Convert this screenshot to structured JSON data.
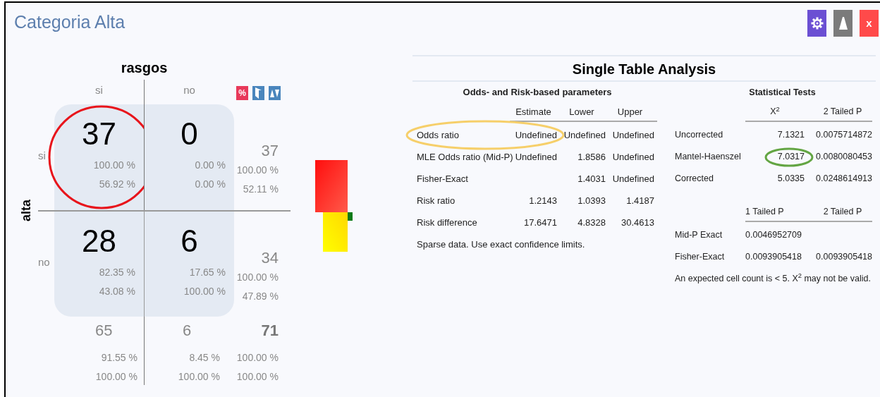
{
  "window": {
    "title": "Categoria Alta",
    "buttons": [
      {
        "kind": "settings"
      },
      {
        "kind": "collapse"
      },
      {
        "kind": "close",
        "label": "x"
      }
    ]
  },
  "crosstab": {
    "column_variable": "rasgos",
    "row_variable": "alta",
    "column_labels": [
      "si",
      "no"
    ],
    "tools": [
      {
        "kind": "percent",
        "label": "%"
      },
      {
        "kind": "swap"
      },
      {
        "kind": "sort"
      }
    ],
    "rows": [
      {
        "label": "si",
        "cells": [
          {
            "count": "37",
            "row_pct": "100.00 %",
            "col_pct": "56.92 %",
            "circled": true
          },
          {
            "count": "0",
            "row_pct": "0.00 %",
            "col_pct": "0.00 %",
            "circled": false
          }
        ],
        "total": {
          "count": "37",
          "row_pct": "100.00 %",
          "col_pct": "52.11 %"
        }
      },
      {
        "label": "no",
        "cells": [
          {
            "count": "28",
            "row_pct": "82.35 %",
            "col_pct": "43.08 %",
            "circled": false
          },
          {
            "count": "6",
            "row_pct": "17.65 %",
            "col_pct": "100.00 %",
            "circled": false
          }
        ],
        "total": {
          "count": "34",
          "row_pct": "100.00 %",
          "col_pct": "47.89 %"
        }
      }
    ],
    "totals": {
      "cells": [
        {
          "count": "65",
          "row_pct": "91.55 %",
          "col_pct": "100.00 %"
        },
        {
          "count": "6",
          "row_pct": "8.45 %",
          "col_pct": "100.00 %"
        }
      ],
      "grand": {
        "count": "71",
        "row_pct": "100.00 %",
        "col_pct": "100.00 %"
      }
    }
  },
  "analysis": {
    "title": "Single Table Analysis",
    "odds": {
      "title": "Odds- and Risk-based parameters",
      "columns": [
        "Estimate",
        "Lower",
        "Upper"
      ],
      "rows": [
        {
          "label": "Odds ratio",
          "values": {
            "estimate": "Undefined",
            "lower": "Undefined",
            "upper": "Undefined"
          },
          "circled": true
        },
        {
          "label": "MLE Odds ratio (Mid-P)",
          "values": {
            "estimate": "Undefined",
            "lower": "1.8586",
            "upper": "Undefined"
          },
          "circled": false
        },
        {
          "label": "Fisher-Exact",
          "values": {
            "lower": "1.4031",
            "upper": "Undefined"
          },
          "circled": false
        },
        {
          "label": "Risk ratio",
          "values": {
            "estimate": "1.2143",
            "lower": "1.0393",
            "upper": "1.4187"
          },
          "circled": false
        },
        {
          "label": "Risk difference",
          "values": {
            "estimate": "17.6471",
            "lower": "4.8328",
            "upper": "30.4613"
          },
          "circled": false
        }
      ],
      "note": "Sparse data. Use exact confidence limits."
    },
    "tests": {
      "title": "Statistical Tests",
      "columns": [
        "X$^{2}$",
        "2 Tailed P"
      ],
      "rows": [
        {
          "label": "Uncorrected",
          "values": {
            "chi_square": "7.1321",
            "two_tailed_p": "0.0075714872"
          },
          "circled": false
        },
        {
          "label": "Mantel-Haenszel",
          "values": {
            "chi_square": "7.0317",
            "two_tailed_p": "0.0080080453"
          },
          "circled": true
        },
        {
          "label": "Corrected",
          "values": {
            "chi_square": "5.0335",
            "two_tailed_p": "0.0248614913"
          },
          "circled": false
        }
      ],
      "exact_columns": [
        "1 Tailed P",
        "2 Tailed P"
      ],
      "exact_rows": [
        {
          "label": "Mid-P Exact",
          "values": {
            "one_tailed_p": "0.0046952709"
          }
        },
        {
          "label": "Fisher-Exact",
          "values": {
            "one_tailed_p": "0.0093905418",
            "two_tailed_p": "0.0093905418"
          }
        }
      ],
      "note": "An expected cell count is < 5. X$^{2}$ may not be valid."
    }
  }
}
